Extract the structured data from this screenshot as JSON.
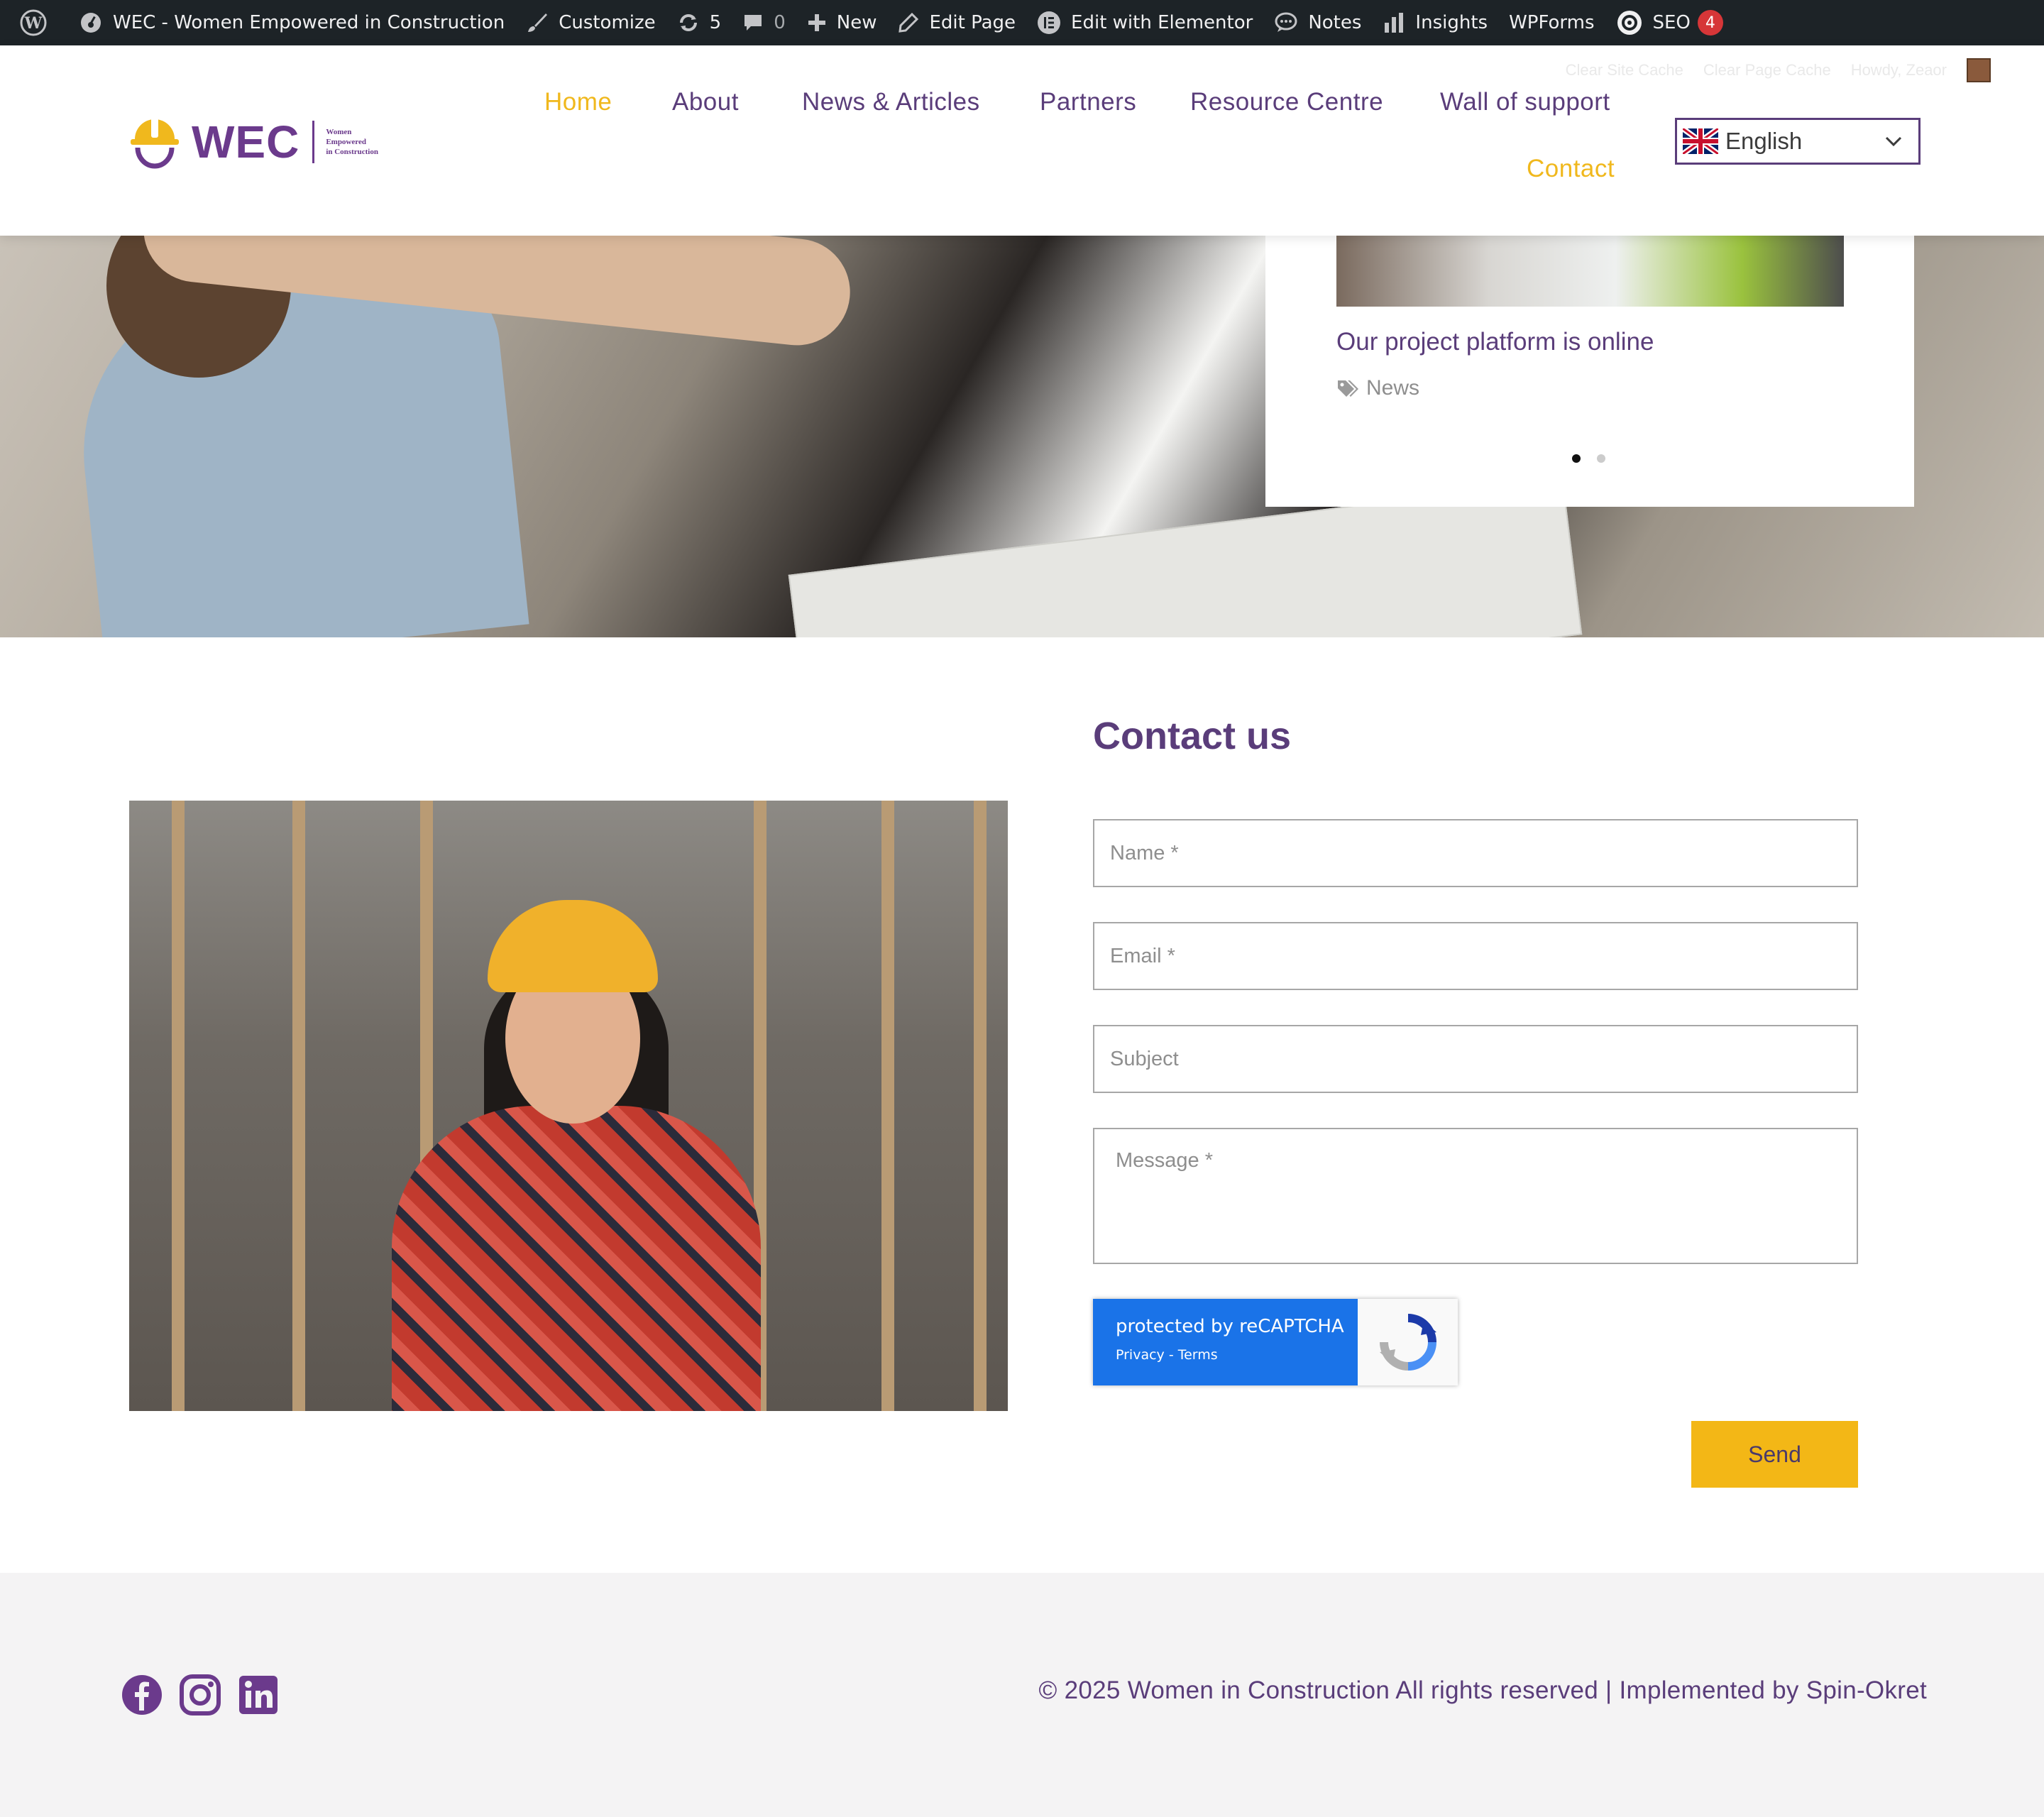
{
  "admin_bar": {
    "site_name": "WEC - Women Empowered in Construction",
    "customize": "Customize",
    "updates_count": "5",
    "comments_count": "0",
    "new": "New",
    "edit_page": "Edit Page",
    "edit_elementor": "Edit with Elementor",
    "notes": "Notes",
    "insights": "Insights",
    "wpforms": "WPForms",
    "seo": "SEO",
    "seo_badge": "4"
  },
  "header": {
    "cache_links": [
      "Clear Site Cache",
      "Clear Page Cache",
      "Howdy, Zeaor"
    ],
    "logo": {
      "word": "WEC",
      "tagline": [
        "Women",
        "Empowered",
        "in Construction"
      ]
    },
    "nav": [
      {
        "label": "Home",
        "active": true
      },
      {
        "label": "About",
        "active": false
      },
      {
        "label": "News & Articles",
        "active": false
      },
      {
        "label": "Partners",
        "active": false
      },
      {
        "label": "Resource Centre",
        "active": false
      },
      {
        "label": "Wall of support",
        "active": false
      },
      {
        "label": "Contact",
        "active": false
      }
    ],
    "language": "English"
  },
  "hero": {
    "card_title": "Our project platform is online",
    "card_tag": "News",
    "slide_count": 2,
    "active_slide": 1
  },
  "contact": {
    "title": "Contact us",
    "name_placeholder": "Name *",
    "email_placeholder": "Email *",
    "subject_placeholder": "Subject",
    "message_placeholder": "Message *",
    "recaptcha_line1": "protected by reCAPTCHA",
    "recaptcha_line2": "Privacy - Terms",
    "send_label": "Send"
  },
  "footer": {
    "social": [
      "facebook-icon",
      "instagram-icon",
      "linkedin-icon"
    ],
    "copyright": "© 2025 Women in Construction All rights reserved | Implemented by Spin-Okret"
  },
  "colors": {
    "admin_bar": "#1d2327",
    "brand_purple": "#5a3d7a",
    "accent_yellow": "#f0b81d",
    "recaptcha_blue": "#1a73e8",
    "footer_bg": "#f4f3f4"
  }
}
